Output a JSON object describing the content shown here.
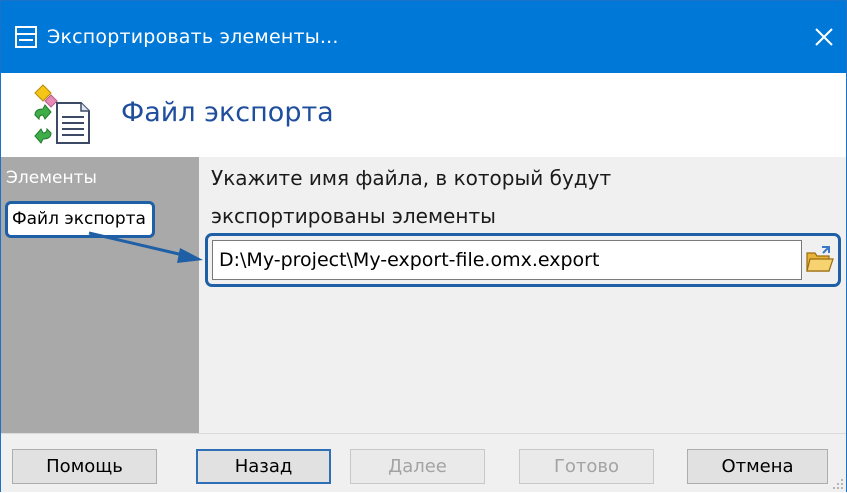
{
  "window": {
    "title": "Экспортировать элементы...",
    "close_glyph": "✕",
    "title_icon": "window-icon",
    "accent_color": "#0078d7"
  },
  "header": {
    "title": "Файл экспорта",
    "icon": "export-file-icon"
  },
  "sidebar": {
    "items": [
      {
        "label": "Элементы",
        "active": false
      },
      {
        "label": "Файл экспорта",
        "active": true
      }
    ],
    "background": "#a9a9a9"
  },
  "main": {
    "instruction_line1": "Укажите имя файла, в который будут",
    "instruction_line2": "экспортированы элементы",
    "path_value": "D:\\My-project\\My-export-file.omx.export",
    "browse_icon": "folder-open-icon",
    "highlight_color": "#1f5fa6"
  },
  "footer": {
    "help_label": "Помощь",
    "back_label": "Назад",
    "next_label": "Далее",
    "finish_label": "Готово",
    "cancel_label": "Отмена"
  }
}
